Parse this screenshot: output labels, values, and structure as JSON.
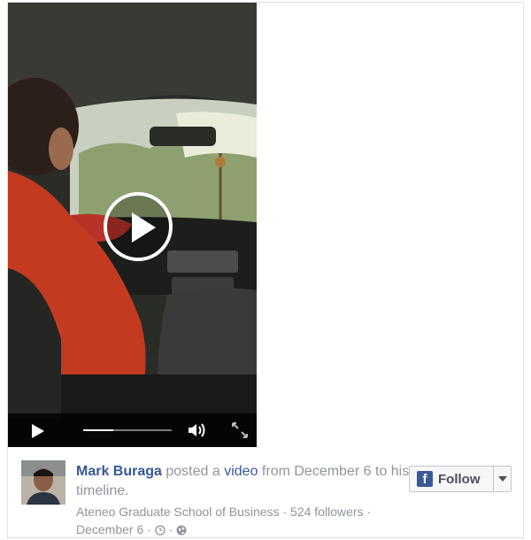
{
  "video": {
    "state": "paused"
  },
  "post": {
    "author_name": "Mark Buraga",
    "action_text_1": "posted a",
    "video_link": "video",
    "action_text_2": "from December 6",
    "action_text_3": "to his timeline.",
    "org": "Ateneo Graduate School of Business",
    "sep1": "·",
    "followers": "524 followers",
    "sep2": "·",
    "date": "December 6",
    "sep3": "·",
    "sep4": "·"
  },
  "follow_button": {
    "icon_letter": "f",
    "label": "Follow"
  },
  "icons": {
    "play": "play-icon",
    "volume": "volume-icon",
    "fullscreen": "fullscreen-icon",
    "clock": "clock-icon",
    "globe": "globe-icon",
    "facebook": "facebook-icon",
    "caret": "chevron-down-icon"
  },
  "colors": {
    "link": "#365899",
    "meta": "#90949c",
    "facebook_blue": "#3b5998",
    "controls_bg": "#000000"
  }
}
